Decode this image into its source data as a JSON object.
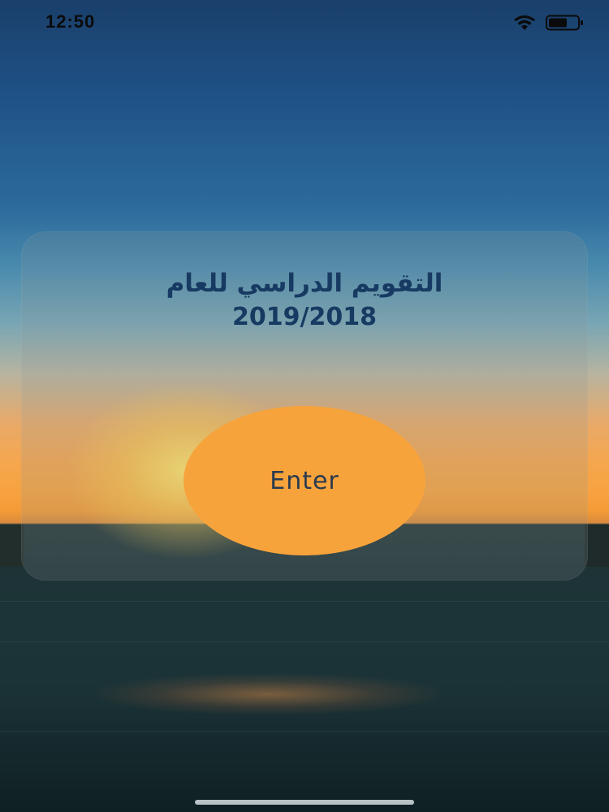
{
  "status_bar": {
    "time": "12:50",
    "wifi_icon": "wifi-icon",
    "battery_icon": "battery-icon"
  },
  "card": {
    "title": "التقويم الدراسي للعام",
    "year": "2019/2018"
  },
  "enter_button": {
    "label": "Enter"
  },
  "colors": {
    "title_text": "#173a62",
    "button_fill": "#f7a33c",
    "button_text": "#2a3a4e"
  }
}
